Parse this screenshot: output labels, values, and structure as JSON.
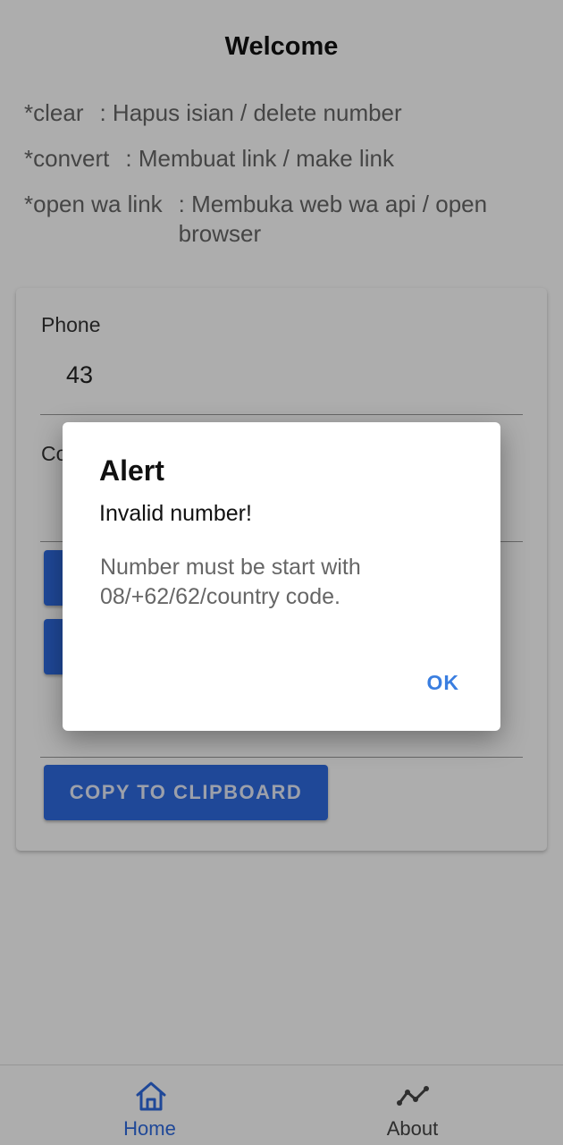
{
  "header": {
    "title": "Welcome"
  },
  "help": [
    {
      "key": "*clear",
      "desc": ": Hapus isian / delete number"
    },
    {
      "key": "*convert",
      "desc": ": Membuat link / make link"
    },
    {
      "key": "*open wa link",
      "desc": ": Membuka web wa api / open browser"
    }
  ],
  "form": {
    "phone_label": "Phone",
    "phone_value": "43",
    "converted_label": "Co",
    "copy_button": "COPY TO CLIPBOARD"
  },
  "dialog": {
    "title": "Alert",
    "subtitle": "Invalid number!",
    "message": "Number must be start with 08/+62/62/country code.",
    "ok_label": "OK"
  },
  "nav": {
    "items": [
      {
        "label": "Home",
        "icon": "home-icon",
        "active": true
      },
      {
        "label": "About",
        "icon": "chart-line-icon",
        "active": false
      }
    ]
  },
  "colors": {
    "accent": "#2f6be0",
    "dialog_action": "#3a7ee0",
    "scrim": "rgba(0,0,0,0.32)"
  }
}
